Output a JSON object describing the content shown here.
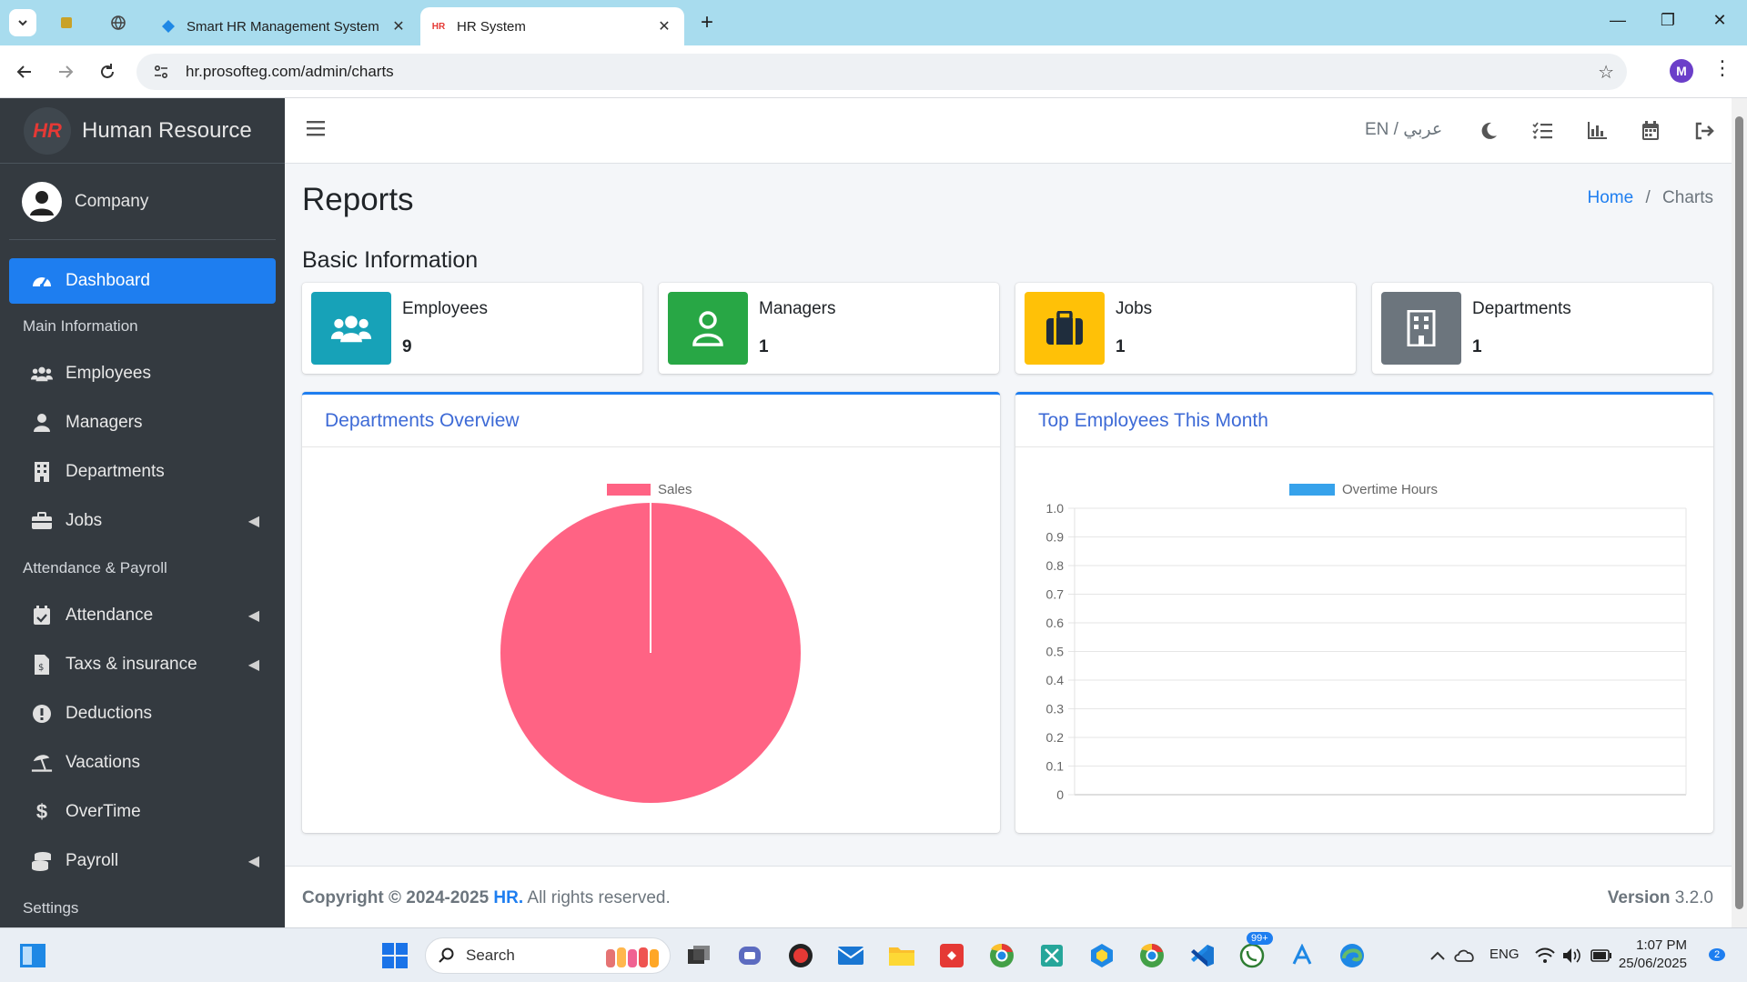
{
  "browser": {
    "tabs": [
      {
        "title": "Smart HR Management System",
        "active": false
      },
      {
        "title": "HR System",
        "active": true
      }
    ],
    "url": "hr.prosofteg.com/admin/charts",
    "profile_initial": "M"
  },
  "sidebar": {
    "brand": "Human Resource",
    "brand_logo": "HR",
    "user": "Company",
    "items": [
      {
        "type": "item",
        "label": "Dashboard",
        "icon": "dashboard-icon",
        "active": true
      },
      {
        "type": "header",
        "label": "Main Information"
      },
      {
        "type": "item",
        "label": "Employees",
        "icon": "users-icon"
      },
      {
        "type": "item",
        "label": "Managers",
        "icon": "user-icon"
      },
      {
        "type": "item",
        "label": "Departments",
        "icon": "building-icon"
      },
      {
        "type": "item",
        "label": "Jobs",
        "icon": "briefcase-icon",
        "expandable": true
      },
      {
        "type": "header",
        "label": "Attendance & Payroll"
      },
      {
        "type": "item",
        "label": "Attendance",
        "icon": "calendar-check-icon",
        "expandable": true
      },
      {
        "type": "item",
        "label": "Taxs & insurance",
        "icon": "invoice-icon",
        "expandable": true
      },
      {
        "type": "item",
        "label": "Deductions",
        "icon": "exclamation-icon"
      },
      {
        "type": "item",
        "label": "Vacations",
        "icon": "umbrella-beach-icon"
      },
      {
        "type": "item",
        "label": "OverTime",
        "icon": "dollar-icon"
      },
      {
        "type": "item",
        "label": "Payroll",
        "icon": "coins-icon",
        "expandable": true
      },
      {
        "type": "header",
        "label": "Settings"
      }
    ]
  },
  "header": {
    "language": "EN / عربي"
  },
  "page": {
    "title": "Reports",
    "breadcrumb_home": "Home",
    "breadcrumb_sep": "/",
    "breadcrumb_current": "Charts",
    "section_title": "Basic Information"
  },
  "info_boxes": [
    {
      "label": "Employees",
      "value": "9",
      "color": "#17a2b8",
      "icon": "users-icon"
    },
    {
      "label": "Managers",
      "value": "1",
      "color": "#28a745",
      "icon": "user-icon"
    },
    {
      "label": "Jobs",
      "value": "1",
      "color": "#ffc107",
      "icon": "briefcase-icon"
    },
    {
      "label": "Departments",
      "value": "1",
      "color": "#6c757d",
      "icon": "building-icon"
    }
  ],
  "cards": {
    "departments_title": "Departments Overview",
    "top_employees_title": "Top Employees This Month"
  },
  "chart_data": [
    {
      "type": "pie",
      "title": "",
      "categories": [
        "Sales"
      ],
      "values": [
        1
      ],
      "colors": [
        "#ff6384"
      ],
      "legend": "top"
    },
    {
      "type": "bar",
      "title": "",
      "categories": [],
      "series": [
        {
          "name": "Overtime Hours",
          "values": [],
          "color": "#36a2eb"
        }
      ],
      "ylim": [
        0,
        1.0
      ],
      "yticks": [
        "1.0",
        "0.9",
        "0.8",
        "0.7",
        "0.6",
        "0.5",
        "0.4",
        "0.3",
        "0.2",
        "0.1",
        "0"
      ],
      "grid": true,
      "legend": "top"
    }
  ],
  "footer": {
    "copyright_prefix": "Copyright © 2024-2025",
    "copyright_brand": "HR.",
    "copyright_suffix": "All rights reserved.",
    "version_label": "Version",
    "version": "3.2.0"
  },
  "taskbar": {
    "search_placeholder": "Search",
    "lang": "ENG",
    "time": "1:07 PM",
    "date": "25/06/2025",
    "whatsapp_badge": "99+",
    "notification_count": "2"
  }
}
